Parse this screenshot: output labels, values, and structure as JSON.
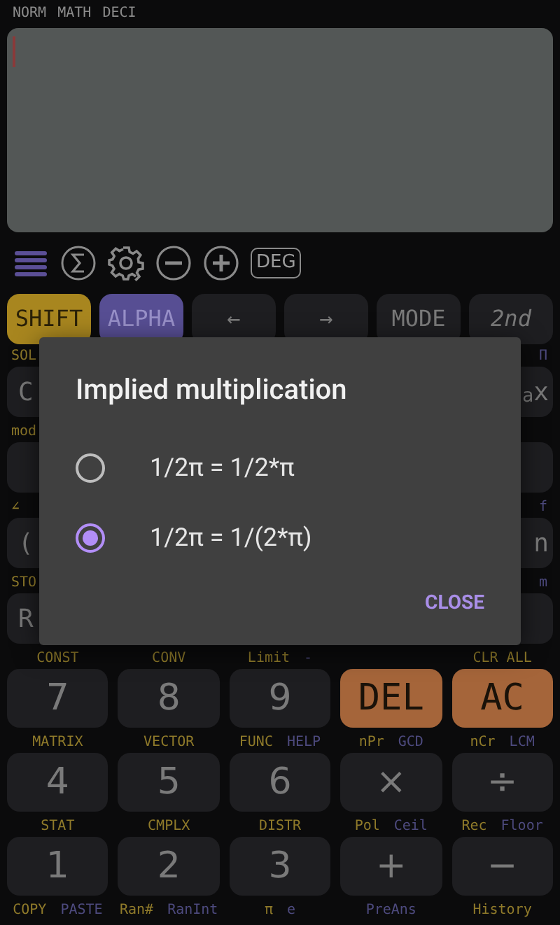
{
  "status_indicators": [
    "NORM",
    "MATH",
    "DECI"
  ],
  "toolbar": {
    "angle_mode": "DEG"
  },
  "top_keys": [
    {
      "label": "SHIFT",
      "kind": "shift"
    },
    {
      "label": "ALPHA",
      "kind": "alpha"
    },
    {
      "label": "←",
      "kind": "plain"
    },
    {
      "label": "→",
      "kind": "plain"
    },
    {
      "label": "MODE",
      "kind": "plain"
    },
    {
      "label": "2nd",
      "kind": "italic"
    }
  ],
  "hidden_rows": [
    {
      "left_label": "SOL",
      "left_key": "C",
      "right_label": "Π",
      "right_key": "$_{a}$x"
    },
    {
      "left_label": "mod"
    },
    {
      "left_label": "∠",
      "left_key": "(",
      "right_label": "f",
      "right_key": "n"
    },
    {
      "left_label": "STO",
      "left_key": "R",
      "right_label": "m"
    }
  ],
  "key_rows": [
    {
      "keys": [
        {
          "label": "7",
          "kind": "digit",
          "labels": [
            {
              "text": "CONST",
              "kind": "shift"
            }
          ]
        },
        {
          "label": "8",
          "kind": "digit",
          "labels": [
            {
              "text": "CONV",
              "kind": "shift"
            }
          ]
        },
        {
          "label": "9",
          "kind": "digit",
          "labels": [
            {
              "text": "Limit",
              "kind": "shift"
            },
            {
              "text": "-",
              "kind": "alpha"
            }
          ]
        },
        {
          "label": "DEL",
          "kind": "clear"
        },
        {
          "label": "AC",
          "kind": "clear",
          "labels": [
            {
              "text": "CLR ALL",
              "kind": "shift"
            }
          ]
        }
      ]
    },
    {
      "keys": [
        {
          "label": "4",
          "kind": "digit",
          "labels": [
            {
              "text": "MATRIX",
              "kind": "shift"
            }
          ]
        },
        {
          "label": "5",
          "kind": "digit",
          "labels": [
            {
              "text": "VECTOR",
              "kind": "shift"
            }
          ]
        },
        {
          "label": "6",
          "kind": "digit",
          "labels": [
            {
              "text": "FUNC",
              "kind": "shift"
            },
            {
              "text": "HELP",
              "kind": "alpha"
            }
          ]
        },
        {
          "label": "×",
          "kind": "digit",
          "labels": [
            {
              "text": "nPr",
              "kind": "shift"
            },
            {
              "text": "GCD",
              "kind": "alpha"
            }
          ]
        },
        {
          "label": "÷",
          "kind": "digit",
          "labels": [
            {
              "text": "nCr",
              "kind": "shift"
            },
            {
              "text": "LCM",
              "kind": "alpha"
            }
          ]
        }
      ]
    },
    {
      "keys": [
        {
          "label": "1",
          "kind": "digit",
          "labels": [
            {
              "text": "STAT",
              "kind": "shift"
            }
          ]
        },
        {
          "label": "2",
          "kind": "digit",
          "labels": [
            {
              "text": "CMPLX",
              "kind": "shift"
            }
          ]
        },
        {
          "label": "3",
          "kind": "digit",
          "labels": [
            {
              "text": "DISTR",
              "kind": "shift"
            }
          ]
        },
        {
          "label": "+",
          "kind": "digit",
          "labels": [
            {
              "text": "Pol",
              "kind": "shift"
            },
            {
              "text": "Ceil",
              "kind": "alpha"
            }
          ]
        },
        {
          "label": "−",
          "kind": "digit",
          "labels": [
            {
              "text": "Rec",
              "kind": "shift"
            },
            {
              "text": "Floor",
              "kind": "alpha"
            }
          ]
        }
      ]
    }
  ],
  "bottom_labels": [
    [
      {
        "text": "COPY",
        "kind": "shift"
      },
      {
        "text": "PASTE",
        "kind": "alpha"
      }
    ],
    [
      {
        "text": "Ran#",
        "kind": "shift"
      },
      {
        "text": "RanInt",
        "kind": "alpha"
      }
    ],
    [
      {
        "text": "π",
        "kind": "shift"
      },
      {
        "text": "e",
        "kind": "alpha"
      }
    ],
    [
      {
        "text": "PreAns",
        "kind": "alpha"
      }
    ],
    [
      {
        "text": "History",
        "kind": "shift"
      }
    ]
  ],
  "dialog": {
    "title": "Implied multiplication",
    "options": [
      {
        "label": "1/2π = 1/2*π",
        "selected": false
      },
      {
        "label": "1/2π = 1/(2*π)",
        "selected": true
      }
    ],
    "button": "CLOSE"
  }
}
